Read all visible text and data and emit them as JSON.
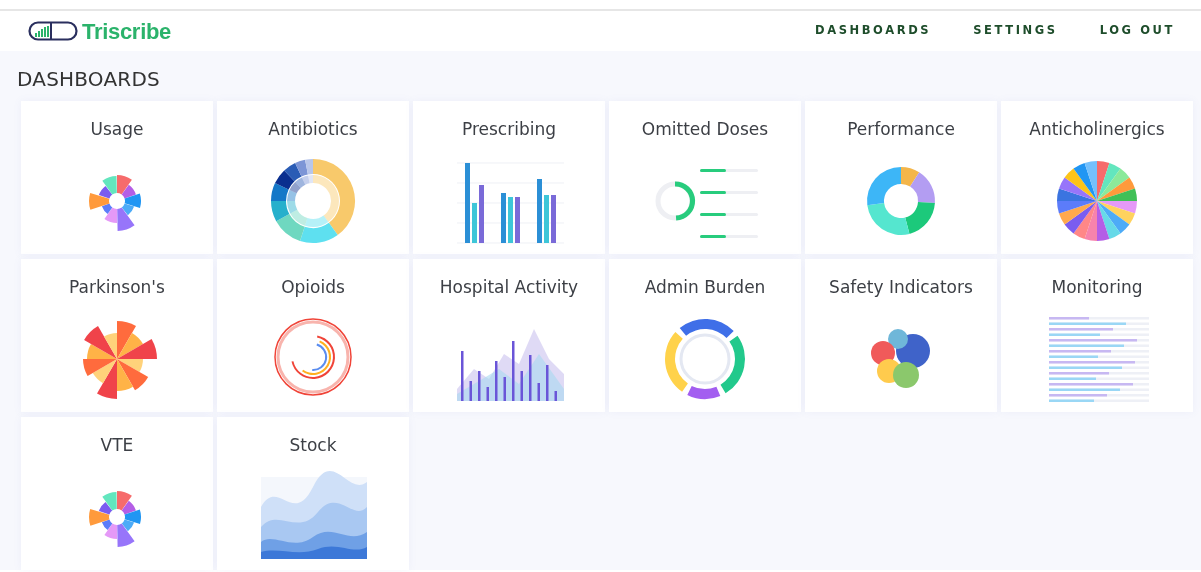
{
  "brand": {
    "name": "Triscribe"
  },
  "nav": [
    {
      "label": "DASHBOARDS"
    },
    {
      "label": "SETTINGS"
    },
    {
      "label": "LOG OUT"
    }
  ],
  "heading": "DASHBOARDS",
  "dashboards": [
    {
      "title": "Usage",
      "kind": "picture"
    },
    {
      "title": "Antibiotics",
      "kind": "picture"
    },
    {
      "title": "Prescribing",
      "kind": "picture"
    },
    {
      "title": "Omitted Doses",
      "kind": "picture"
    },
    {
      "title": "Performance",
      "kind": "picture"
    },
    {
      "title": "Anticholinergics",
      "kind": "picture"
    },
    {
      "title": "Parkinson's",
      "kind": "picture"
    },
    {
      "title": "Opioids",
      "kind": "picture"
    },
    {
      "title": "Hospital Activity",
      "kind": "picture"
    },
    {
      "title": "Admin Burden",
      "kind": "picture"
    },
    {
      "title": "Safety Indicators",
      "kind": "picture"
    },
    {
      "title": "Monitoring",
      "kind": "picture"
    },
    {
      "title": "VTE",
      "kind": "picture"
    },
    {
      "title": "Stock",
      "kind": "picture"
    }
  ]
}
